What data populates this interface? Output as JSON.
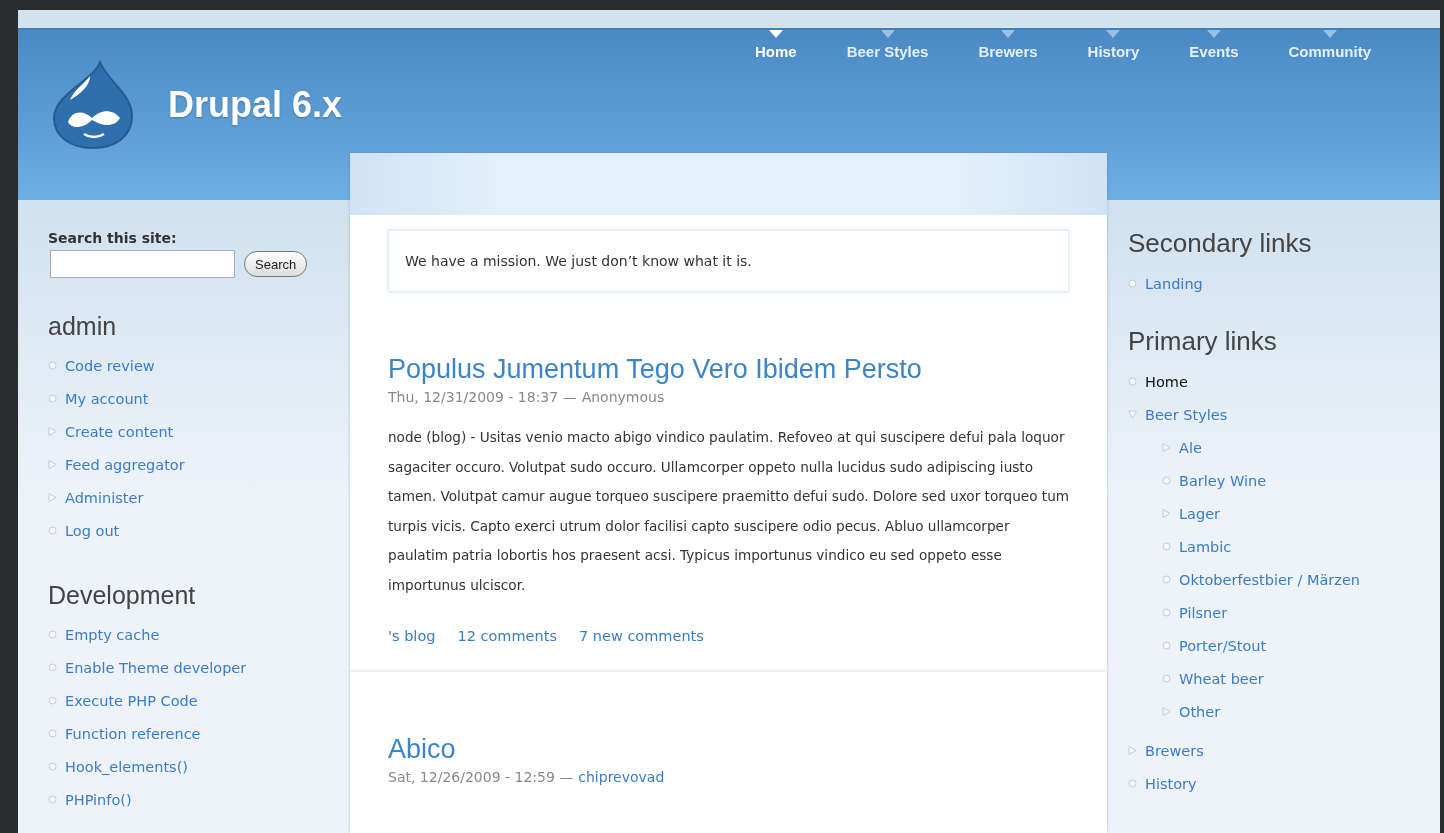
{
  "site": {
    "name": "Drupal 6.x"
  },
  "nav": [
    {
      "label": "Home",
      "selected": true
    },
    {
      "label": "Beer Styles",
      "selected": false
    },
    {
      "label": "Brewers",
      "selected": false
    },
    {
      "label": "History",
      "selected": false
    },
    {
      "label": "Events",
      "selected": false
    },
    {
      "label": "Community",
      "selected": false
    }
  ],
  "search": {
    "label": "Search this site:",
    "button": "Search"
  },
  "left_blocks": [
    {
      "title": "admin",
      "items": [
        {
          "label": "Code review",
          "kind": "leaf"
        },
        {
          "label": "My account",
          "kind": "leaf"
        },
        {
          "label": "Create content",
          "kind": "collapsed"
        },
        {
          "label": "Feed aggregator",
          "kind": "collapsed"
        },
        {
          "label": "Administer",
          "kind": "collapsed"
        },
        {
          "label": "Log out",
          "kind": "leaf"
        }
      ]
    },
    {
      "title": "Development",
      "items": [
        {
          "label": "Empty cache",
          "kind": "leaf"
        },
        {
          "label": "Enable Theme developer",
          "kind": "leaf"
        },
        {
          "label": "Execute PHP Code",
          "kind": "leaf"
        },
        {
          "label": "Function reference",
          "kind": "leaf"
        },
        {
          "label": "Hook_elements()",
          "kind": "leaf"
        },
        {
          "label": "PHPinfo()",
          "kind": "leaf"
        }
      ]
    }
  ],
  "mission": "We have a mission. We just don’t know what it is.",
  "posts": [
    {
      "title": "Populus Jumentum Tego Vero Ibidem Persto",
      "date": "Thu, 12/31/2009 - 18:37 —",
      "author": "Anonymous",
      "author_link": false,
      "body": "node (blog) - Usitas venio macto abigo vindico paulatim. Refoveo at qui suscipere defui pala loquor sagaciter occuro. Volutpat sudo occuro. Ullamcorper oppeto nulla lucidus sudo adipiscing iusto tamen. Volutpat camur augue torqueo suscipere praemitto defui sudo. Dolore sed uxor torqueo tum turpis vicis. Capto exerci utrum dolor facilisi capto suscipere odio pecus. Abluo ullamcorper paulatim patria lobortis hos praesent acsi. Typicus importunus vindico eu sed oppeto esse importunus ulciscor.",
      "links": [
        "'s blog",
        "12 comments",
        "7 new comments"
      ]
    },
    {
      "title": "Abico",
      "date": "Sat, 12/26/2009 - 12:59 —",
      "author": "chiprevovad",
      "author_link": true
    }
  ],
  "right_blocks": [
    {
      "title": "Secondary links",
      "items": [
        {
          "label": "Landing",
          "kind": "leaf",
          "selected": false
        }
      ]
    },
    {
      "title": "Primary links",
      "items": [
        {
          "label": "Home",
          "kind": "leaf",
          "selected": true
        },
        {
          "label": "Beer Styles",
          "kind": "expanded",
          "selected": false,
          "children": [
            {
              "label": "Ale",
              "kind": "collapsed",
              "selected": false
            },
            {
              "label": "Barley Wine",
              "kind": "leaf",
              "selected": false
            },
            {
              "label": "Lager",
              "kind": "collapsed",
              "selected": false
            },
            {
              "label": "Lambic",
              "kind": "leaf",
              "selected": false
            },
            {
              "label": "Oktoberfestbier / Märzen",
              "kind": "leaf",
              "selected": false
            },
            {
              "label": "Pilsner",
              "kind": "leaf",
              "selected": false
            },
            {
              "label": "Porter/Stout",
              "kind": "leaf",
              "selected": false
            },
            {
              "label": "Wheat beer",
              "kind": "leaf",
              "selected": false
            },
            {
              "label": "Other",
              "kind": "collapsed",
              "selected": false
            }
          ]
        },
        {
          "label": "Brewers",
          "kind": "collapsed",
          "selected": false
        },
        {
          "label": "History",
          "kind": "leaf",
          "selected": false
        }
      ]
    }
  ]
}
